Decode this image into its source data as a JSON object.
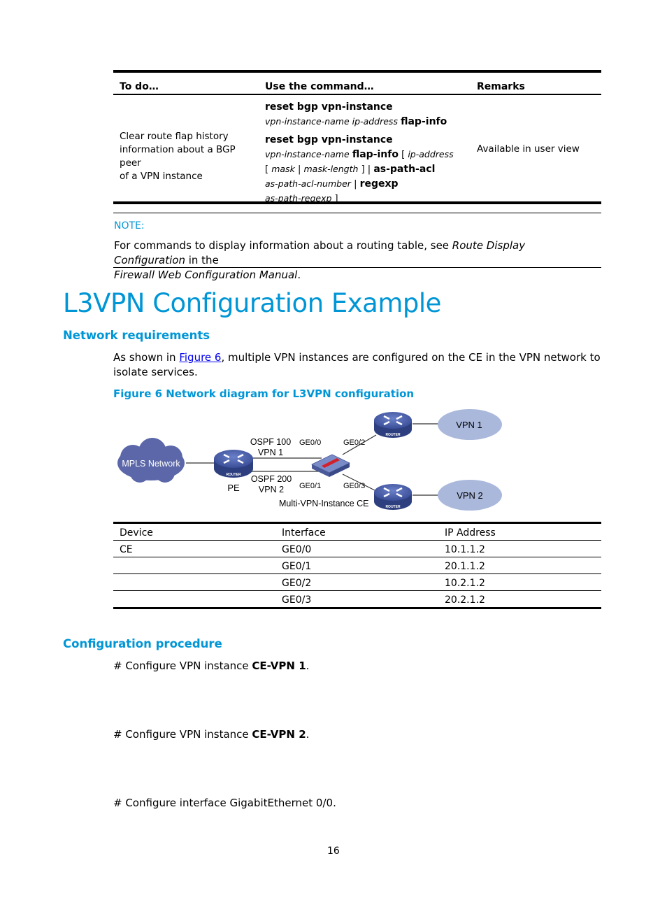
{
  "command_table": {
    "headers": [
      "To do…",
      "Use the command…",
      "Remarks"
    ],
    "rows": [
      {
        "todo": [
          "Clear route flap history",
          "information about a BGP peer",
          "of a VPN instance"
        ],
        "commands": [
          {
            "line1_bold": "reset bgp vpn-instance",
            "line2_italic": "vpn-instance-name ip-address",
            "line2_bold": "flap-info"
          },
          {
            "line1_bold": "reset bgp vpn-instance",
            "line2_italic": "vpn-instance-name",
            "line2_bold": "flap-info",
            "line2_tail_plain": "[",
            "line2_tail_italic": "ip-address",
            "line3_plain_a": "[",
            "line3_italic_a": "mask",
            "line3_plain_b": "|",
            "line3_italic_b": "mask-length",
            "line3_plain_c": "] |",
            "line3_bold": "as-path-acl",
            "line4_italic": "as-path-acl-number",
            "line4_plain": "|",
            "line4_bold": "regexp",
            "line5_italic": "as-path-regexp",
            "line5_plain": "]"
          }
        ],
        "remarks": "Available in user view"
      }
    ]
  },
  "note": {
    "label": "NOTE:",
    "text_a": "For commands to display information about a routing table, see ",
    "text_italic_1": "Route Display Configuration",
    "text_b": " in the",
    "text_italic_2": "Firewall Web Configuration Manual",
    "text_c": "."
  },
  "section_title": "L3VPN Configuration Example",
  "network_requirements": {
    "heading": "Network requirements",
    "para_a": "As shown in ",
    "link": "Figure 6",
    "para_b": ", multiple VPN instances are configured on the CE in the VPN network to isolate services."
  },
  "figure": {
    "caption": "Figure 6 Network diagram for L3VPN configuration",
    "labels": {
      "cloud": "MPLS Network",
      "pe": "PE",
      "ospf100": "OSPF 100",
      "vpn1_link": "VPN 1",
      "ospf200": "OSPF 200",
      "vpn2_link": "VPN 2",
      "ge00": "GE0/0",
      "ge01": "GE0/1",
      "ge02": "GE0/2",
      "ge03": "GE0/3",
      "ce": "Multi-VPN-Instance CE",
      "vpn1": "VPN 1",
      "vpn2": "VPN 2",
      "router_tag": "ROUTER"
    },
    "colors": {
      "cloud": "#5b67a8",
      "router": "#4a5ea8",
      "vpn_ellipse": "#aab8dc",
      "switch": "#7a8cc8",
      "switch_accent": "#d4202a"
    }
  },
  "address_table": {
    "headers": [
      "Device",
      "Interface",
      "IP Address"
    ],
    "rows": [
      [
        "CE",
        "GE0/0",
        "10.1.1.2"
      ],
      [
        "",
        "GE0/1",
        "20.1.1.2"
      ],
      [
        "",
        "GE0/2",
        "10.2.1.2"
      ],
      [
        "",
        "GE0/3",
        "20.2.1.2"
      ]
    ]
  },
  "configuration_procedure": {
    "heading": "Configuration procedure",
    "steps": [
      {
        "text": "# Configure VPN instance ",
        "bold": "CE-VPN 1",
        "end": "."
      },
      {
        "text": "# Configure VPN instance ",
        "bold": "CE-VPN 2",
        "end": "."
      },
      {
        "text": "# Configure interface GigabitEthernet 0/0.",
        "bold": "",
        "end": ""
      }
    ]
  },
  "page_number": "16"
}
